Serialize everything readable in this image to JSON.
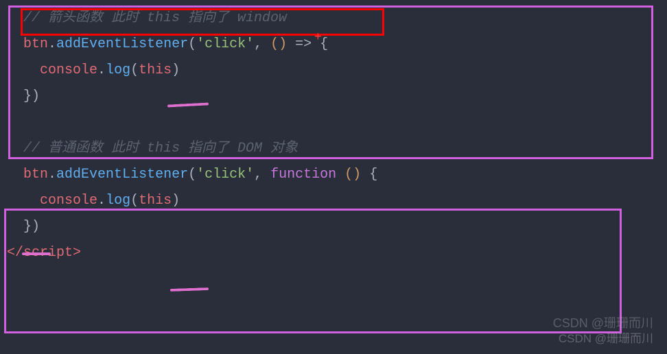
{
  "code": {
    "line1_comment": "// 箭头函数 此时 this 指向了 window",
    "line2_btn": "btn",
    "line2_dot1": ".",
    "line2_method": "addEventListener",
    "line2_open": "(",
    "line2_str": "'click'",
    "line2_comma": ", ",
    "line2_paren": "()",
    "line2_arrow": " => ",
    "line2_brace": "{",
    "line3_indent": "  ",
    "line3_console": "console",
    "line3_dot": ".",
    "line3_log": "log",
    "line3_open": "(",
    "line3_this": "this",
    "line3_close": ")",
    "line4": "})",
    "blank": " ",
    "line6_comment": "// 普通函数 此时 this 指向了 DOM 对象",
    "line7_btn": "btn",
    "line7_dot1": ".",
    "line7_method": "addEventListener",
    "line7_open": "(",
    "line7_str": "'click'",
    "line7_comma": ", ",
    "line7_func": "function ",
    "line7_paren": "()",
    "line7_space": " ",
    "line7_brace": "{",
    "line8_indent": "  ",
    "line8_console": "console",
    "line8_dot": ".",
    "line8_log": "log",
    "line8_open": "(",
    "line8_this": "this",
    "line8_close": ")",
    "line9": "})",
    "line10_tag_open": "</",
    "line10_tag": "script",
    "line10_tag_close": ">"
  },
  "watermark": {
    "w1": "CSDN @珊珊而川",
    "w2": "CSDN @珊珊而川"
  },
  "annotation": {
    "cross": "+"
  }
}
